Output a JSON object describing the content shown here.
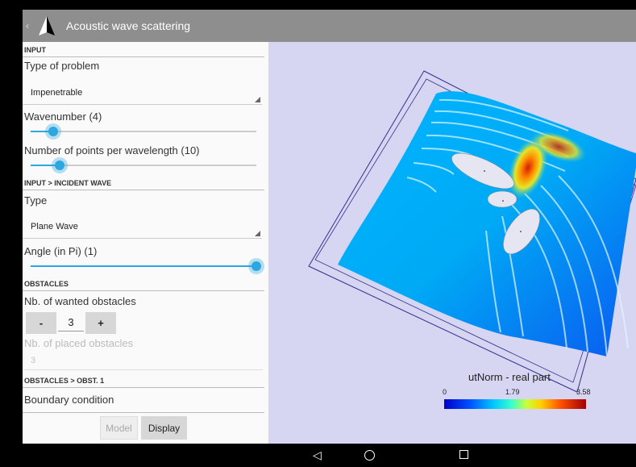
{
  "app": {
    "title": "Acoustic wave scattering",
    "back_glyph": "‹"
  },
  "sections": {
    "input": "INPUT",
    "incident": "INPUT > INCIDENT WAVE",
    "obstacles": "OBSTACLES",
    "obst1": "OBSTACLES > OBST. 1"
  },
  "fields": {
    "type_of_problem": {
      "label": "Type of problem",
      "value": "Impenetrable"
    },
    "wavenumber": {
      "label": "Wavenumber (4)",
      "level": 0.1
    },
    "points_per_wavelength": {
      "label": "Number of points per wavelength (10)",
      "level": 0.13
    },
    "wave_type": {
      "label": "Type",
      "value": "Plane Wave"
    },
    "angle": {
      "label": "Angle (in Pi) (1)",
      "level": 1.0
    },
    "wanted_obstacles": {
      "label": "Nb. of wanted obstacles",
      "value": "3",
      "minus": "-",
      "plus": "+"
    },
    "placed_obstacles": {
      "label": "Nb. of placed obstacles",
      "value": "3"
    },
    "boundary": {
      "label": "Boundary condition"
    }
  },
  "buttons": {
    "model": "Model",
    "display": "Display"
  },
  "colorbar": {
    "title": "utNorm - real part",
    "min": "0",
    "mid": "1.79",
    "max": "3.58"
  },
  "nav": {
    "back": "◁"
  },
  "colors": {
    "accent": "#2ea6df",
    "appbar": "#8e8e8e",
    "viz_bg": "#d6d5f2"
  }
}
